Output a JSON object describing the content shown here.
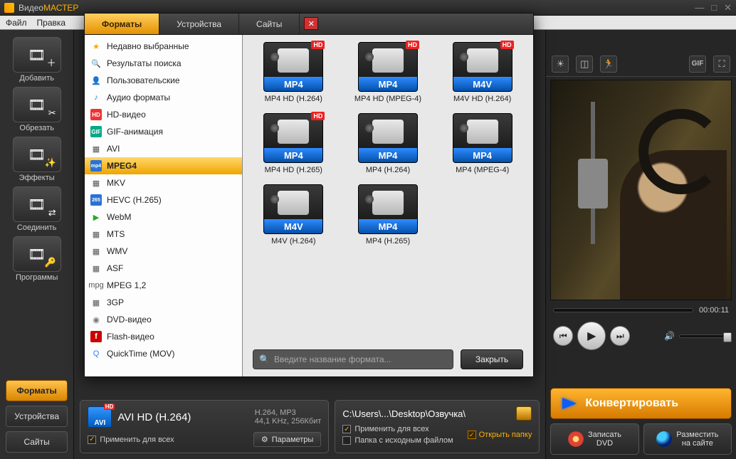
{
  "title": {
    "brand1": "Видео",
    "brand2": "МАСТЕР"
  },
  "win": {
    "min": "—",
    "max": "□",
    "close": "✕"
  },
  "menu": {
    "file": "Файл",
    "edit": "Правка"
  },
  "toolbar": [
    {
      "label": "Добавить",
      "mini": "＋"
    },
    {
      "label": "Обрезать",
      "mini": "✂"
    },
    {
      "label": "Эффекты",
      "mini": "✨"
    },
    {
      "label": "Соединить",
      "mini": "⇄"
    },
    {
      "label": "Программы",
      "mini": "🔑"
    }
  ],
  "btabs": {
    "formats": "Форматы",
    "devices": "Устройства",
    "sites": "Сайты"
  },
  "preview": {
    "time": "00:00:11"
  },
  "actions": {
    "convert": "Конвертировать",
    "dvd": "Записать\nDVD",
    "web": "Разместить\nна сайте"
  },
  "fmtpanel": {
    "name": "AVI HD (H.264)",
    "line1": "H.264, MP3",
    "line2": "44,1 KHz, 256Кбит",
    "apply": "Применить для всех",
    "params": "Параметры"
  },
  "fldpanel": {
    "path": "C:\\Users\\...\\Desktop\\Озвучка\\",
    "apply": "Применить для всех",
    "same": "Папка с исходным файлом",
    "open": "Открыть папку"
  },
  "popup": {
    "tabs": {
      "formats": "Форматы",
      "devices": "Устройства",
      "sites": "Сайты"
    },
    "side": [
      {
        "t": "Недавно выбранные",
        "ic": "star",
        "g": "★"
      },
      {
        "t": "Результаты поиска",
        "ic": "mag",
        "g": "🔍"
      },
      {
        "t": "Пользовательские",
        "ic": "user",
        "g": "👤"
      },
      {
        "t": "Аудио форматы",
        "ic": "note",
        "g": "♪"
      },
      {
        "t": "HD-видео",
        "ic": "hd",
        "g": "HD"
      },
      {
        "t": "GIF-анимация",
        "ic": "gif",
        "g": "GIF"
      },
      {
        "t": "AVI",
        "ic": "film",
        "g": "▦"
      },
      {
        "t": "MPEG4",
        "ic": "mp4",
        "g": "mp4",
        "active": true
      },
      {
        "t": "MKV",
        "ic": "film",
        "g": "▦"
      },
      {
        "t": "HEVC (H.265)",
        "ic": "h265",
        "g": "265"
      },
      {
        "t": "WebM",
        "ic": "play",
        "g": "▶"
      },
      {
        "t": "MTS",
        "ic": "film",
        "g": "▦"
      },
      {
        "t": "WMV",
        "ic": "film",
        "g": "▦"
      },
      {
        "t": "ASF",
        "ic": "film",
        "g": "▦"
      },
      {
        "t": "MPEG 1,2",
        "ic": "film",
        "g": "mpg"
      },
      {
        "t": "3GP",
        "ic": "film",
        "g": "▦"
      },
      {
        "t": "DVD-видео",
        "ic": "disc",
        "g": "◉"
      },
      {
        "t": "Flash-видео",
        "ic": "flash",
        "g": "f"
      },
      {
        "t": "QuickTime (MOV)",
        "ic": "qt",
        "g": "Q"
      }
    ],
    "grid": [
      {
        "tag": "MP4",
        "cap": "MP4 HD (H.264)",
        "hd": true
      },
      {
        "tag": "MP4",
        "cap": "MP4 HD (MPEG-4)",
        "hd": true
      },
      {
        "tag": "M4V",
        "cap": "M4V HD (H.264)",
        "hd": true
      },
      {
        "tag": "MP4",
        "cap": "MP4 HD (H.265)",
        "hd": true
      },
      {
        "tag": "MP4",
        "cap": "MP4 (H.264)",
        "hd": false
      },
      {
        "tag": "MP4",
        "cap": "MP4 (MPEG-4)",
        "hd": false
      },
      {
        "tag": "M4V",
        "cap": "M4V (H.264)",
        "hd": false
      },
      {
        "tag": "MP4",
        "cap": "MP4 (H.265)",
        "hd": false
      }
    ],
    "search_ph": "Введите название формата...",
    "close": "Закрыть"
  }
}
